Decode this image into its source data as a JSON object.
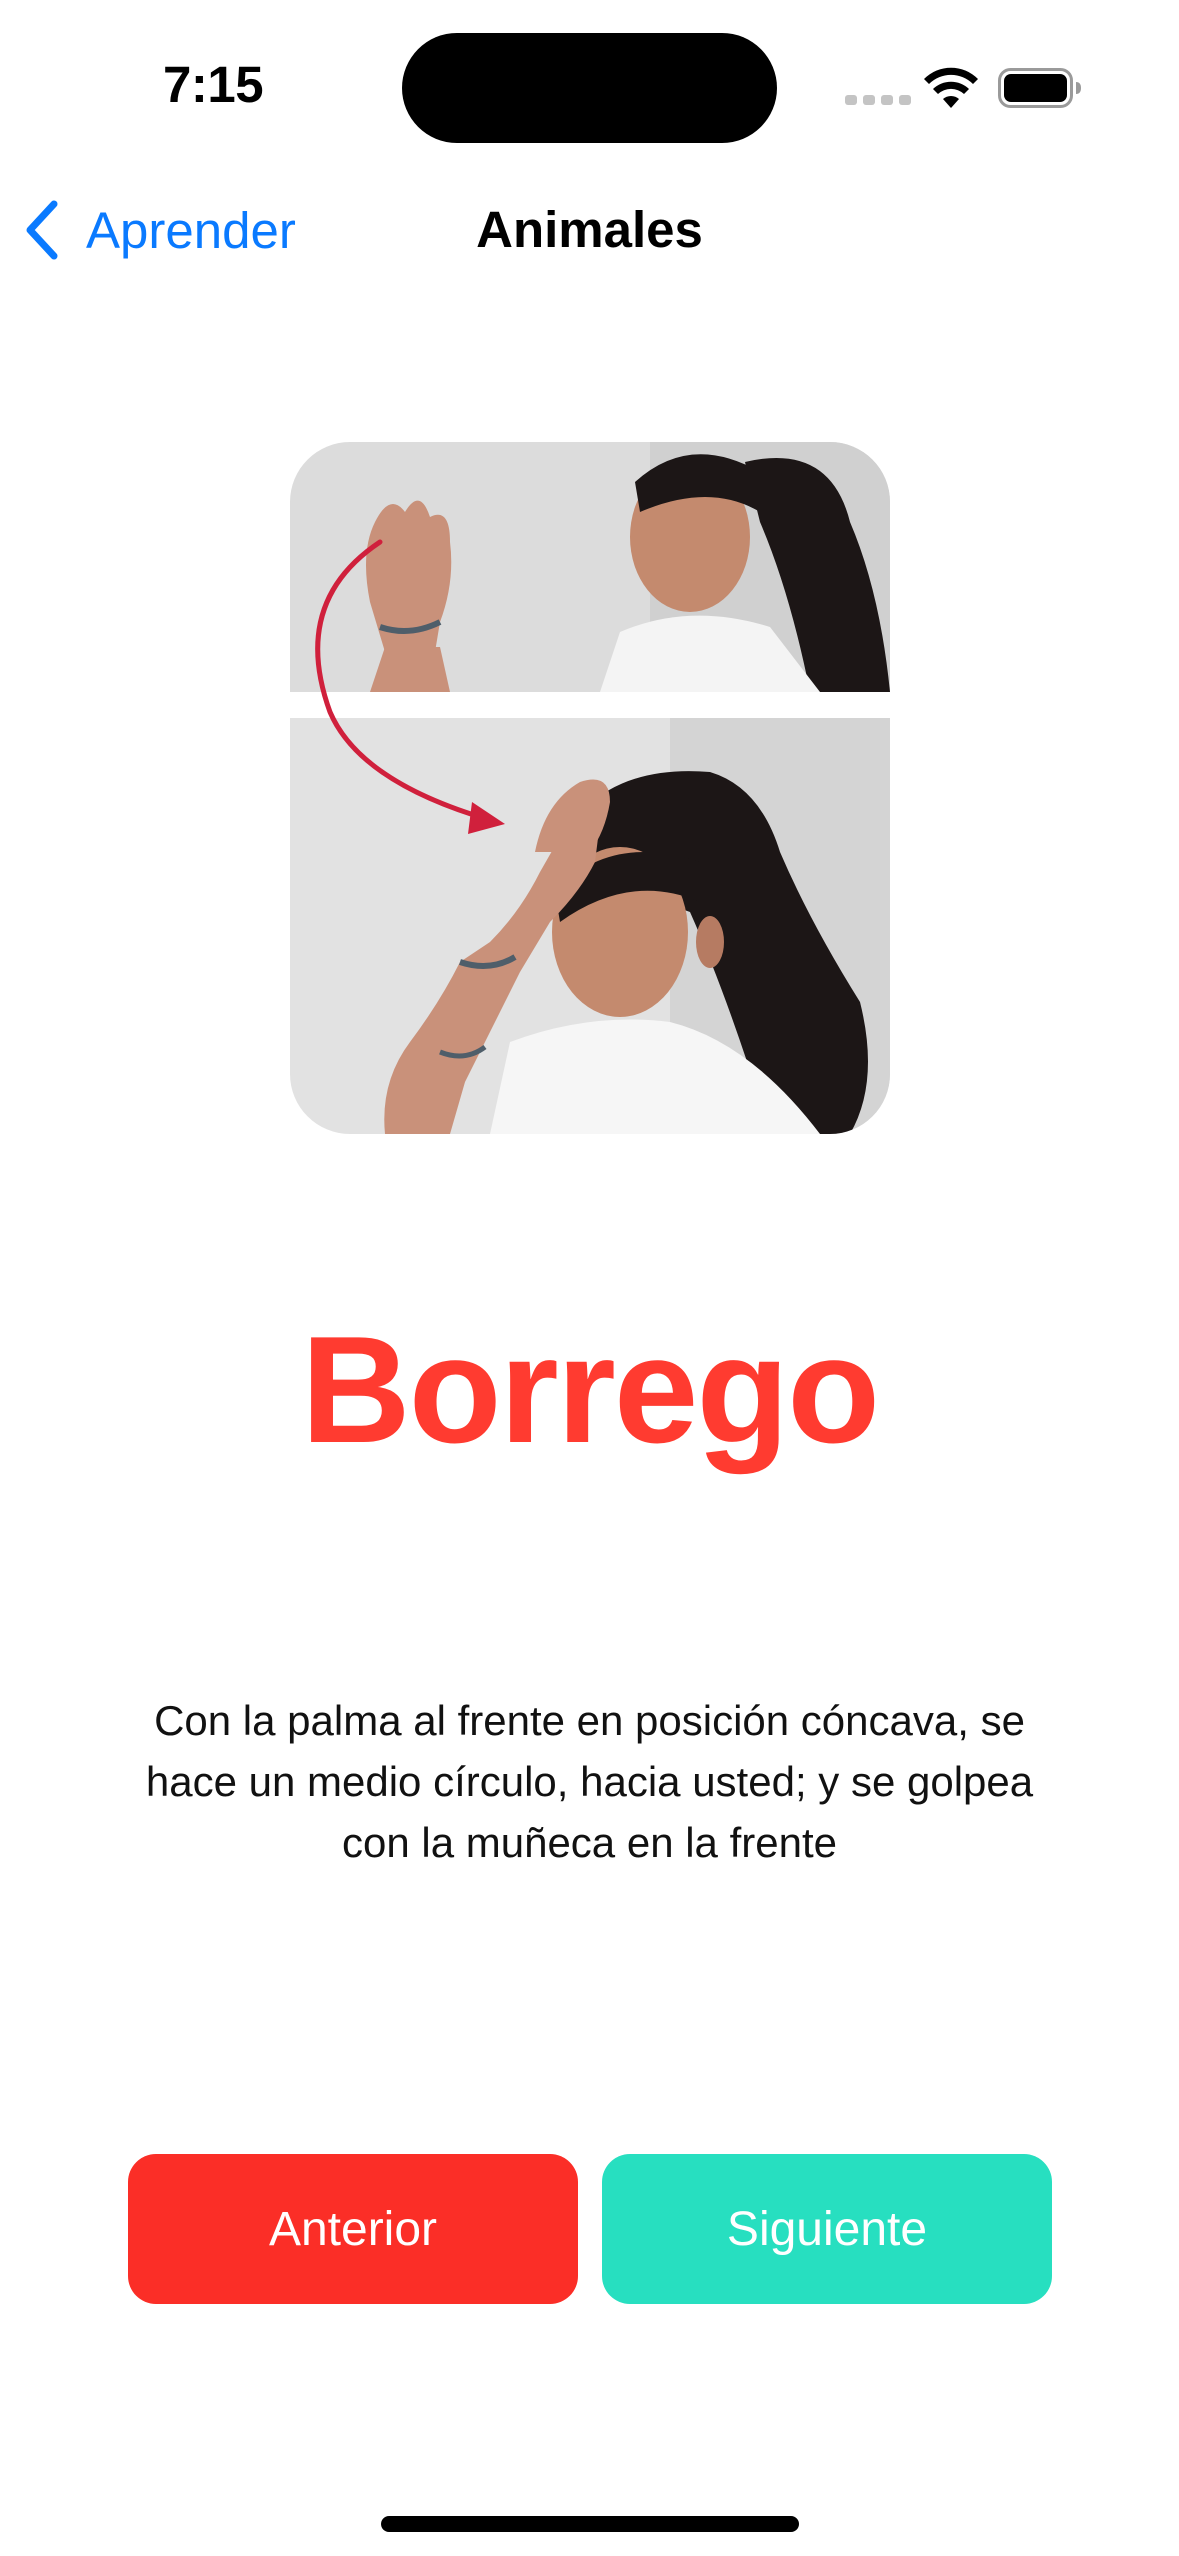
{
  "status_bar": {
    "time": "7:15",
    "signal_icon": "cellular-signal-icon",
    "wifi_icon": "wifi-icon",
    "battery_icon": "battery-full-icon"
  },
  "nav": {
    "back_label": "Aprender",
    "back_icon": "chevron-left-icon",
    "title": "Animales"
  },
  "sign": {
    "image_description": "Sign-language photo: girl moving a cupped palm in a half circle toward herself and tapping her forehead with the wrist",
    "arrow_color": "#d0203c"
  },
  "word": {
    "text": "Borrego",
    "color": "#ff3b30"
  },
  "description": {
    "text": "Con la palma al frente en posición cóncava, se hace un medio círculo, hacia usted; y se golpea con la muñeca en la frente"
  },
  "buttons": {
    "previous_label": "Anterior",
    "previous_color": "#fb2e27",
    "next_label": "Siguiente",
    "next_color": "#27dfc0"
  }
}
